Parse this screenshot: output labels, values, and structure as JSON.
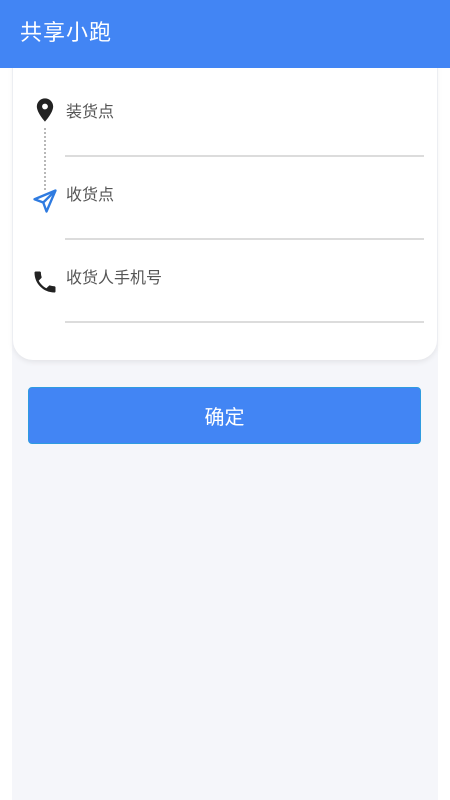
{
  "header": {
    "title": "共享小跑"
  },
  "form": {
    "pickup": {
      "label": "装货点",
      "value": "",
      "icon": "location-pin-icon"
    },
    "delivery": {
      "label": "收货点",
      "value": "",
      "icon": "navigation-arrow-icon"
    },
    "phone": {
      "label": "收货人手机号",
      "value": "",
      "icon": "phone-icon"
    }
  },
  "confirm_label": "确定",
  "colors": {
    "primary": "#4285f4",
    "page_background": "#f5f6fa",
    "icon_dark": "#222222",
    "icon_blue": "#2f7be0",
    "divider": "#dcdcdc"
  }
}
